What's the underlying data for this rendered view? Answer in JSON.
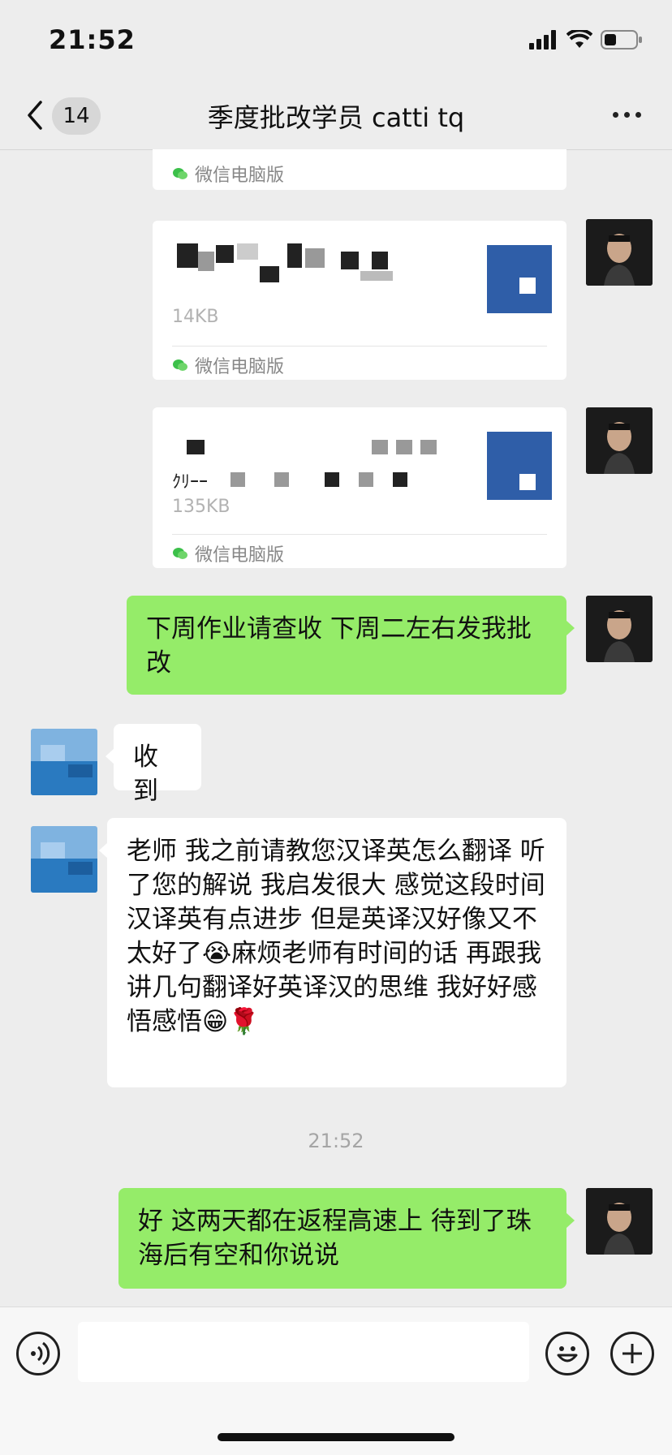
{
  "status_bar": {
    "time": "21:52"
  },
  "nav": {
    "back_badge": "14",
    "title": "季度批改学员 catti tq"
  },
  "files": [
    {
      "size": "",
      "source": "微信电脑版"
    },
    {
      "size": "14KB",
      "source": "微信电脑版"
    },
    {
      "size": "135KB",
      "source": "微信电脑版",
      "name_fragment": "ｸﾘｰｰ"
    }
  ],
  "messages": [
    {
      "side": "right",
      "text": "下周作业请查收 下周二左右发我批改"
    },
    {
      "side": "left",
      "text": "收到"
    },
    {
      "side": "left",
      "text": "老师 我之前请教您汉译英怎么翻译  听了您的解说 我启发很大 感觉这段时间汉译英有点进步 但是英译汉好像又不太好了😭麻烦老师有时间的话 再跟我讲几句翻译好英译汉的思维  我好好感悟感悟😁🌹"
    },
    {
      "side": "right",
      "text": "好 这两天都在返程高速上 待到了珠海后有空和你说说"
    }
  ],
  "timestamp": "21:52",
  "colors": {
    "bubble_self": "#95ec69",
    "bubble_other": "#ffffff",
    "background": "#ededed",
    "file_icon": "#2f5ea8"
  },
  "icons": [
    "back-chevron-icon",
    "more-icon",
    "voice-icon",
    "emoji-icon",
    "plus-icon",
    "wechat-icon",
    "file-icon"
  ]
}
